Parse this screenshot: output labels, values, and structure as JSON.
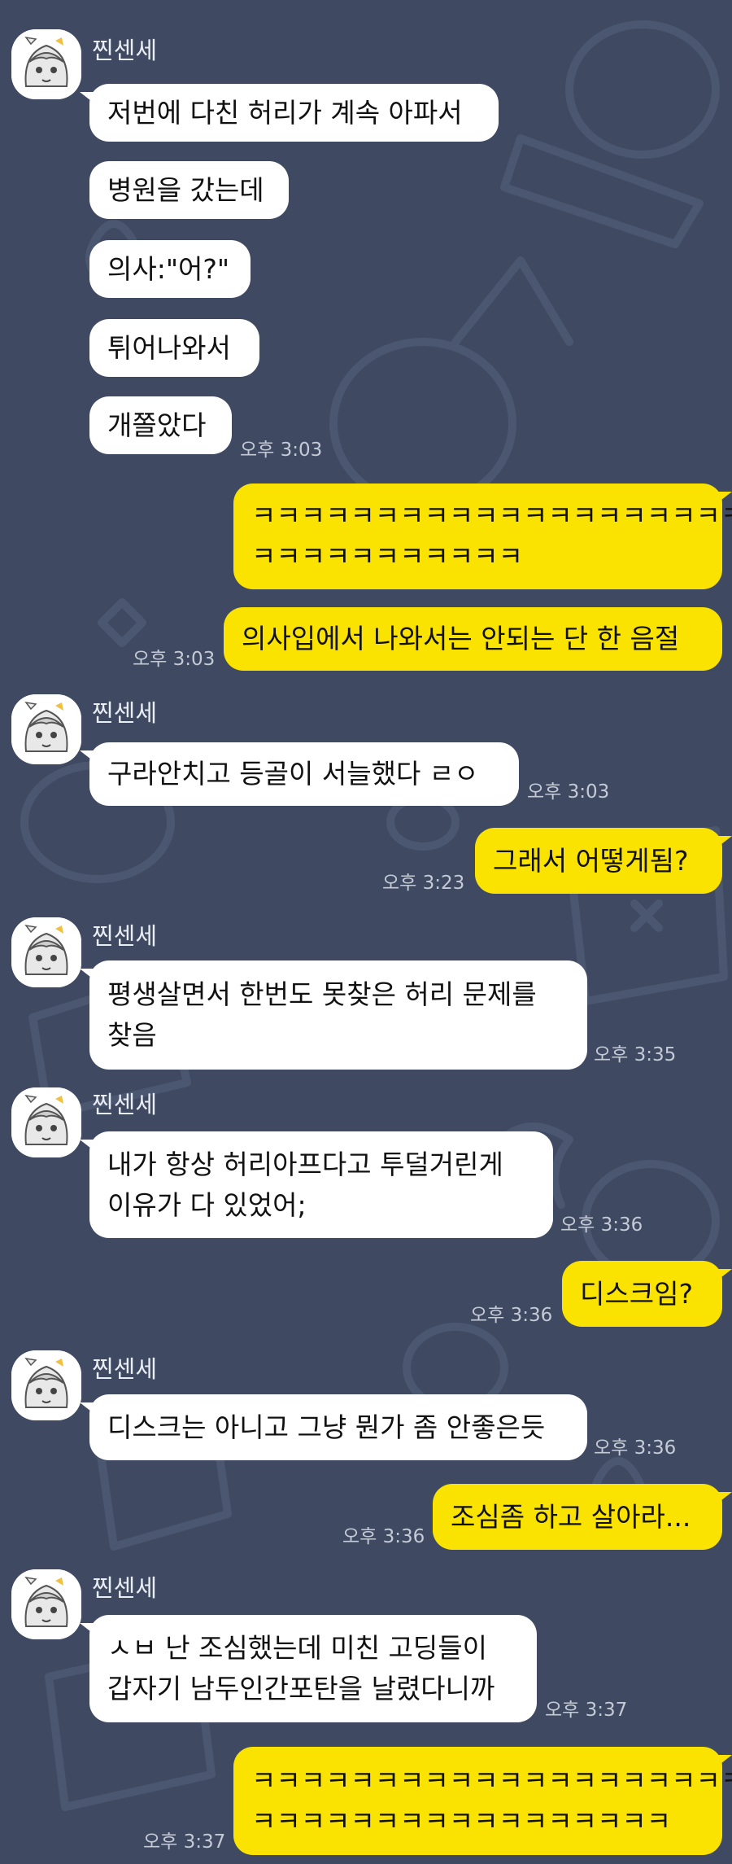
{
  "sender": {
    "name": "찐센세"
  },
  "messages": [
    {
      "text": "저번에 다친 허리가 계속 아파서"
    },
    {
      "text": "병원을 갔는데"
    },
    {
      "text": "의사:\"어?\""
    },
    {
      "text": "튀어나와서"
    },
    {
      "text": "개쫄았다",
      "time": "오후 3:03"
    },
    {
      "line1": "ㅋㅋㅋㅋㅋㅋㅋㅋㅋㅋㅋㅋㅋㅋㅋㅋㅋㅋㅋㅋ",
      "line2": "ㅋㅋㅋㅋㅋㅋㅋㅋㅋㅋㅋ"
    },
    {
      "text": "의사입에서 나와서는 안되는 단 한 음절",
      "time": "오후 3:03"
    },
    {
      "text": "구라안치고 등골이 서늘했다 ㄹㅇ",
      "time": "오후 3:03"
    },
    {
      "text": "그래서 어떻게됨?",
      "time": "오후 3:23"
    },
    {
      "line1": "평생살면서 한번도 못찾은 허리 문제를",
      "line2": "찾음",
      "time": "오후 3:35"
    },
    {
      "line1": "내가 항상 허리아프다고 투덜거린게",
      "line2": "이유가 다 있었어;",
      "time": "오후 3:36"
    },
    {
      "text": "디스크임?",
      "time": "오후 3:36"
    },
    {
      "text": "디스크는 아니고 그냥 뭔가 좀 안좋은듯",
      "time": "오후 3:36"
    },
    {
      "text": "조심좀 하고 살아라...",
      "time": "오후 3:36"
    },
    {
      "line1": "ㅅㅂ 난 조심했는데 미친 고딩들이",
      "line2": "갑자기 남두인간포탄을 날렸다니까",
      "time": "오후 3:37"
    },
    {
      "line1": "ㅋㅋㅋㅋㅋㅋㅋㅋㅋㅋㅋㅋㅋㅋㅋㅋㅋㅋㅋㅋ",
      "line2": "ㅋㅋㅋㅋㅋㅋㅋㅋㅋㅋㅋㅋㅋㅋㅋㅋㅋ",
      "time": "오후 3:37"
    }
  ],
  "colors": {
    "background": "#3f4a62",
    "incoming_bubble": "#ffffff",
    "outgoing_bubble": "#fae300",
    "text": "#111111",
    "time": "#c4cad6",
    "name": "#e9edf4"
  },
  "icons": {
    "avatar": "anime-character-avatar-icon"
  }
}
